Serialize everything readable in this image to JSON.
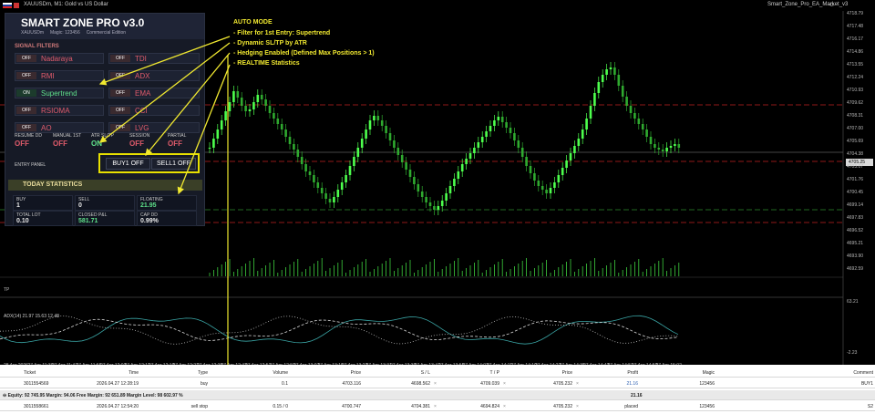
{
  "window": {
    "chart_title": "XAUUSDm, M1: Gold vs US Dollar",
    "ea_name": "Smart_Zone_Pro_EA_Market_v3"
  },
  "panel": {
    "title": "SMART ZONE PRO  v3.0",
    "subtitle": "XAUUSDm     Magic: 123456     Commercial Edition",
    "filters_label": "SIGNAL FILTERS",
    "filters": [
      {
        "state": "OFF",
        "name": "Nadaraya",
        "on": false
      },
      {
        "state": "OFF",
        "name": "TDI",
        "on": false
      },
      {
        "state": "OFF",
        "name": "RMI",
        "on": false
      },
      {
        "state": "OFF",
        "name": "ADX",
        "on": false
      },
      {
        "state": "ON",
        "name": "Supertrend",
        "on": true
      },
      {
        "state": "OFF",
        "name": "EMA",
        "on": false
      },
      {
        "state": "OFF",
        "name": "RSIOMA",
        "on": false
      },
      {
        "state": "OFF",
        "name": "CCI",
        "on": false
      },
      {
        "state": "OFF",
        "name": "AO",
        "on": false
      },
      {
        "state": "OFF",
        "name": "LVG",
        "on": false
      }
    ],
    "status": [
      {
        "label": "RESUME DD",
        "value": "OFF",
        "on": false
      },
      {
        "label": "MANUAL 1ST",
        "value": "OFF",
        "on": false
      },
      {
        "label": "ATR SL/TP",
        "value": "ON",
        "on": true
      },
      {
        "label": "SESSION",
        "value": "OFF",
        "on": false
      },
      {
        "label": "PARTIAL",
        "value": "OFF",
        "on": false
      }
    ],
    "entry_label": "ENTRY PANEL",
    "buy_label": "BUY1 OFF",
    "sell_label": "SELL1 OFF",
    "today_label": "TODAY STATISTICS",
    "stats": [
      {
        "label": "BUY",
        "value": "1",
        "green": false
      },
      {
        "label": "SELL",
        "value": "0",
        "green": false
      },
      {
        "label": "FLOATING",
        "value": "21.95",
        "green": true
      },
      {
        "label": "TOTAL LOT",
        "value": "0.10",
        "green": false
      },
      {
        "label": "CLOSED P&L",
        "value": "581.71",
        "green": true
      },
      {
        "label": "CAP DD",
        "value": "0.99%",
        "green": false
      }
    ]
  },
  "annotations": {
    "auto_mode": "AUTO MODE",
    "filter": "- Filter for 1st Entry: Supertrend",
    "sltp": "- Dynamic SL/TP by ATR",
    "hedging": "- Hedging Enabled (Defined Max Positions > 1)",
    "stats": "- REALTIME Statistics"
  },
  "chart": {
    "price_box": "4705.25",
    "y_ticks": [
      "4718.79",
      "4717.48",
      "4716.17",
      "4714.86",
      "4713.55",
      "4712.24",
      "4710.93",
      "4709.62",
      "4708.31",
      "4707.00",
      "4705.69",
      "4704.38",
      "4703.07",
      "4701.76",
      "4700.45",
      "4699.14",
      "4697.83",
      "4696.52",
      "4695.21",
      "4693.90",
      "4692.59"
    ],
    "x_ticks": [
      "28 Apr 2026",
      "27 Apr 11:39",
      "27 Apr 11:47",
      "27 Apr 11:55",
      "27 Apr 12:03",
      "27 Apr 12:11",
      "27 Apr 12:19",
      "27 Apr 12:27",
      "27 Apr 12:35",
      "27 Apr 12:43",
      "27 Apr 12:51",
      "27 Apr 12:59",
      "27 Apr 13:07",
      "27 Apr 13:15",
      "27 Apr 13:23",
      "27 Apr 13:31",
      "27 Apr 13:39",
      "27 Apr 13:47",
      "27 Apr 13:55",
      "27 Apr 14:03",
      "27 Apr 14:11",
      "27 Apr 14:19",
      "27 Apr 14:27",
      "27 Apr 14:35",
      "27 Apr 14:43",
      "27 Apr 14:51",
      "27 Apr 14:59",
      "27 Apr 15:02"
    ],
    "sub_title": "ADX(14) 21.97 15.63 12.48",
    "sub_ticks": [
      "63.21",
      "-2.23"
    ],
    "tp_label": "TP"
  },
  "table": {
    "headers": [
      "Ticket",
      "Time",
      "Type",
      "Volume",
      "Price",
      "S / L",
      "T / P",
      "Price",
      "Profit",
      "Magic",
      "Comment"
    ],
    "rows": [
      [
        "3011554569",
        "2026.04.27 12:28:19",
        "buy",
        "0.1",
        "4703.116",
        "4698.562",
        "4709.039",
        "4705.232",
        "21.16",
        "123456",
        "BUY1"
      ],
      [
        "3011558661",
        "2026.04.27 12:54:20",
        "sell stop",
        "0.15 / 0",
        "4700.747",
        "4704.381",
        "4694.824",
        "4705.232",
        "placed",
        "123456",
        "S2"
      ]
    ],
    "account": "Equity: 92 745.95  Margin: 94.06  Free Margin: 92 651.89  Margin Level: 98 602.97 %",
    "account_profit": "21.16"
  },
  "colors": {
    "annotation": "#f0e830",
    "candle": "#4dff4d",
    "filter_off": "#e05b6b",
    "filter_on": "#5fe08a"
  }
}
